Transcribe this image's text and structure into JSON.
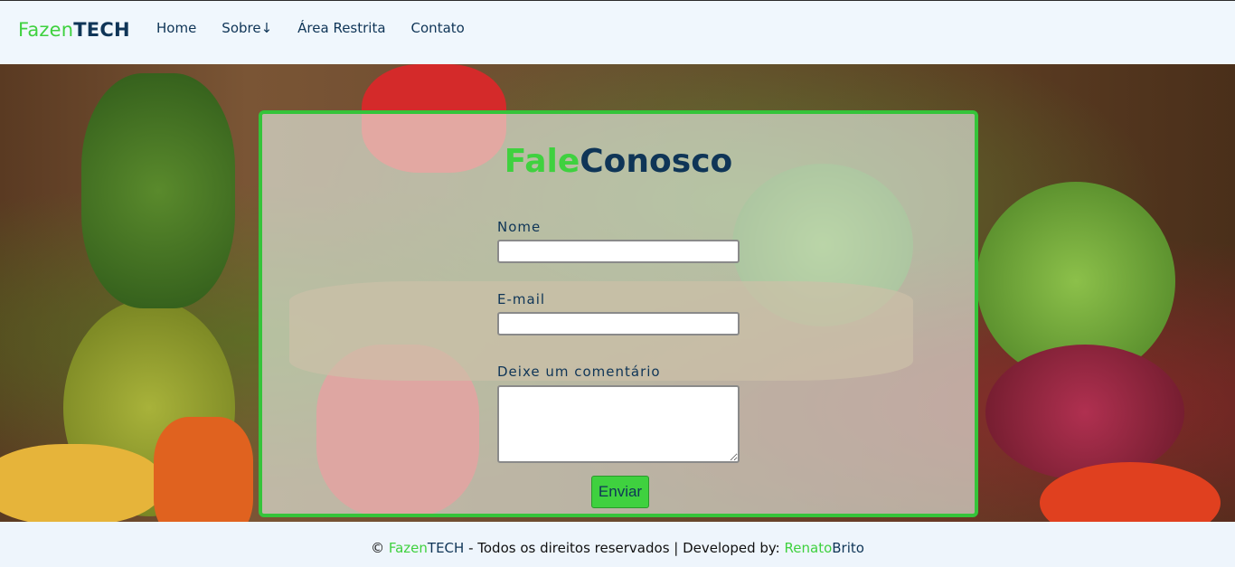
{
  "brand": {
    "part1": "Fazen",
    "part2": "TECH"
  },
  "nav": [
    {
      "label": "Home"
    },
    {
      "label": "Sobre↓"
    },
    {
      "label": "Área Restrita"
    },
    {
      "label": "Contato"
    }
  ],
  "form": {
    "title_part1": "Fale",
    "title_part2": "Conosco",
    "name_label": "Nome",
    "email_label": "E-mail",
    "comment_label": "Deixe um comentário",
    "name_value": "",
    "email_value": "",
    "comment_value": "",
    "submit_label": "Enviar"
  },
  "footer": {
    "copyright": "© ",
    "brand_part1": "Fazen",
    "brand_part2": "TECH",
    "rights": " - Todos os direitos reservados | Developed by: ",
    "dev_part1": "Renato",
    "dev_part2": "Brito"
  },
  "colors": {
    "accent_green": "#3fd13f",
    "navy": "#0f3557",
    "border_green": "#35c43a"
  }
}
